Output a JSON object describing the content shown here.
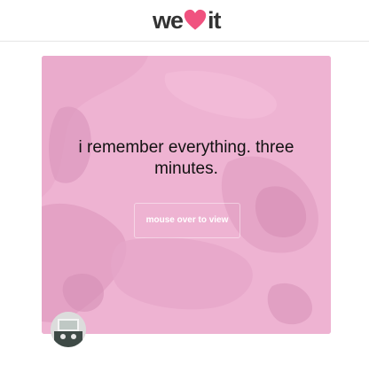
{
  "header": {
    "logo_text_left": "we",
    "logo_text_right": "it",
    "logo_heart_color": "#f0527f"
  },
  "post": {
    "quote": "i remember everything. three minutes.",
    "hover_label": "mouse over to view",
    "background_color": "#eeb3d2"
  },
  "user": {
    "avatar_icon": "user-avatar-icon"
  }
}
